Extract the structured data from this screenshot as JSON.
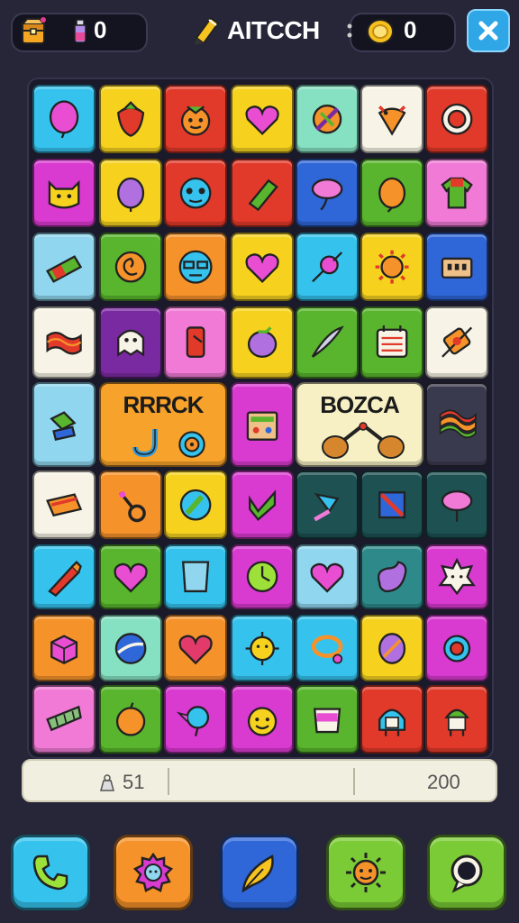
{
  "header": {
    "left_counter": "0",
    "title": "AITCCH",
    "right_counter": "0"
  },
  "board": {
    "special_tiles": [
      {
        "label": "RRRCK",
        "color": "#f7a22a"
      },
      {
        "label": "BOZCA",
        "color": "#f6f0c4"
      }
    ]
  },
  "score": {
    "left_value": "51",
    "right_value": "200"
  },
  "colors": {
    "red": "#e23a2a",
    "yellow": "#f6d21f",
    "orange": "#f6922a",
    "green": "#58b52d",
    "teal": "#2e8a8a",
    "cyan": "#35c3ee",
    "blue": "#2f66d8",
    "purple": "#7a2aa0",
    "magenta": "#d93ad0",
    "pink": "#f07ad6",
    "white": "#f7f3e6",
    "mint": "#86e0c2",
    "darkteal": "#1d5152",
    "sky": "#8fd6ee",
    "dark": "#3a3a4e"
  }
}
